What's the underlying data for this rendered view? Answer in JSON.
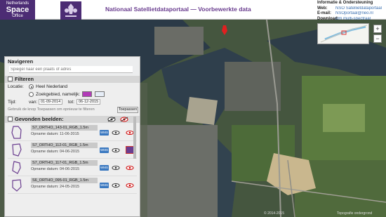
{
  "header": {
    "logo": {
      "line1": "Netherlands",
      "line2": "Space",
      "line3": "Office"
    },
    "title": "Nationaal Satellietdataportaal — Voorbewerkte data",
    "info": {
      "heading": "Informatie & Ondersteuning",
      "web_key": "Web:",
      "web_val": "NSO Satellietdataportaal",
      "email_key": "E-mail:",
      "email_val": "NSOportaal@neo.nl",
      "download_key": "Download:",
      "download_val": "Dm multi-spectraal"
    }
  },
  "map": {
    "zoom_in": "+",
    "zoom_out": "−",
    "attribution": "© 2014-2015",
    "attribution2": "Topografie ondergrond"
  },
  "panel": {
    "nav_title": "Navigeren",
    "search_placeholder": "Spiegel naar een plaats of adres",
    "filters_title": "Filteren",
    "locatie_label": "Locatie:",
    "opt_nl": "Heel Nederland",
    "opt_zoek": "Zoekgebied, namelijk:",
    "tijd_label": "Tijd:",
    "van_label": "van:",
    "van_value": "01-09-2014",
    "tot_label": "tot:",
    "tot_value": "06-12-2015",
    "hint": "Gebruik de knop Toepassen om opnieuw te filteren",
    "apply": "Toepassen",
    "found_title": "Gevonden beelden:",
    "items": [
      {
        "name": "S7_ORTHO_143-01_RGB_1.5m",
        "date": "Opname datum: 11-06-2015",
        "wms": "WMS"
      },
      {
        "name": "S7_ORTHO_112-01_RGB_1.5m",
        "date": "Opname datum: 04-06-2015",
        "wms": "WMS"
      },
      {
        "name": "S7_ORTHO_117-01_RGB_1.5m",
        "date": "Opname datum: 04-06-2015",
        "wms": "WMS"
      },
      {
        "name": "S6_ORTHO_095-01_RGB_1.5m",
        "date": "Opname datum: 24-05-2015",
        "wms": "WMS"
      }
    ]
  },
  "colors": {
    "brand": "#4c2c74",
    "title": "#6a3d8f",
    "link": "#3a6fb0",
    "wms": "#3a78c0"
  }
}
